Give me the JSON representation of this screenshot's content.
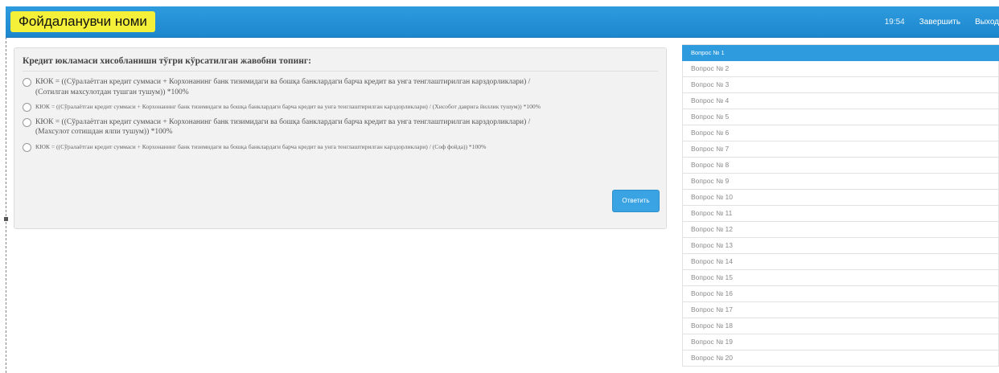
{
  "header": {
    "username": "Фойдаланувчи номи",
    "time": "19:54",
    "finish_label": "Завершить",
    "exit_label": "Выход"
  },
  "question": {
    "title": "Кредит юкламаси хисобланишн тўгри кўрсатилган жавобни топинг:",
    "answers": [
      {
        "text": "КЮК = ((Сўралаётган кредит суммаси + Корхонанинг банк тизимидаги ва бошқа банклардаги барча кредит ва унга тенглаштирилган карздорликлари) / (Сотилган махсулотдан тушган тушум)) *100%",
        "size": "big"
      },
      {
        "text": "КЮК = ((Сўралаётган кредит суммаси + Корхонанинг банк тизимидаги ва бошқа банклардаги барча кредит ва унга тенглаштирилган карздорликлари) / (Хисобот даврига йиллик тушум)) *100%",
        "size": "small"
      },
      {
        "text": "КЮК = ((Сўралаётган кредит суммаси + Корхонанинг банк тизимидаги ва бошқа банклардаги барча кредит ва унга тенглаштирилган карздорликлари) / (Махсулот сотишдан ялпи тушум)) *100%",
        "size": "big"
      },
      {
        "text": "КЮК = ((Сўралаётган кредит суммаси + Корхонанинг банк тизимидаги ва бошқа банклардаги барча кредит ва унга тенглаштирилган карздорликлари) / (Соф фойда)) *100%",
        "size": "small"
      }
    ],
    "submit_label": "Ответить"
  },
  "question_list": [
    "Вопрос № 1",
    "Вопрос № 2",
    "Вопрос № 3",
    "Вопрос № 4",
    "Вопрос № 5",
    "Вопрос № 6",
    "Вопрос № 7",
    "Вопрос № 8",
    "Вопрос № 9",
    "Вопрос № 10",
    "Вопрос № 11",
    "Вопрос № 12",
    "Вопрос № 13",
    "Вопрос № 14",
    "Вопрос № 15",
    "Вопрос № 16",
    "Вопрос № 17",
    "Вопрос № 18",
    "Вопрос № 19",
    "Вопрос № 20"
  ],
  "active_question_index": 0,
  "colors": {
    "topbar": "#1c87cc",
    "username_highlight": "#f4f03a",
    "active_item": "#2f9bdf"
  }
}
